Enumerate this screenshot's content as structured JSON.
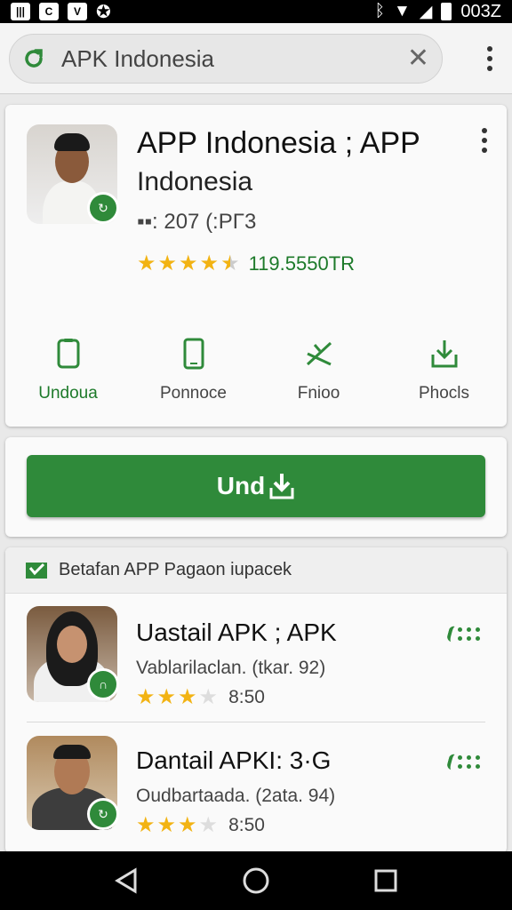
{
  "status": {
    "icons": [
      "gallery-icon",
      "c-app-icon",
      "vpn-icon",
      "tools-icon"
    ],
    "time": "003Z"
  },
  "search": {
    "query": "APK Indonesia"
  },
  "app": {
    "title": "APP Indonesia ; APP",
    "subtitle": "Indonesia",
    "meta": "▪▪: 207 (:PΓ3",
    "rating_stars": 4.5,
    "rating_text": "119.5550TR",
    "actions": [
      {
        "label": "Undoua",
        "icon": "tablet-icon"
      },
      {
        "label": "Ponnoce",
        "icon": "phone-icon"
      },
      {
        "label": "Fnioo",
        "icon": "share-icon"
      },
      {
        "label": "Phocls",
        "icon": "download-tray-icon"
      }
    ]
  },
  "download_button": {
    "label": "Und"
  },
  "related": {
    "header": "Betafan APP Pagaon iupacek",
    "items": [
      {
        "name": "Uastail APK  ; APK",
        "desc": "Vablarilaclan. (tkar. 92)",
        "stars": 3,
        "time": "8:50"
      },
      {
        "name": "Dantail APKI: 3·G",
        "desc": "Oudbartaada. (2ata. 94)",
        "stars": 3,
        "time": "8:50"
      }
    ]
  },
  "colors": {
    "accent": "#2f8a3a",
    "star": "#f2b313"
  }
}
